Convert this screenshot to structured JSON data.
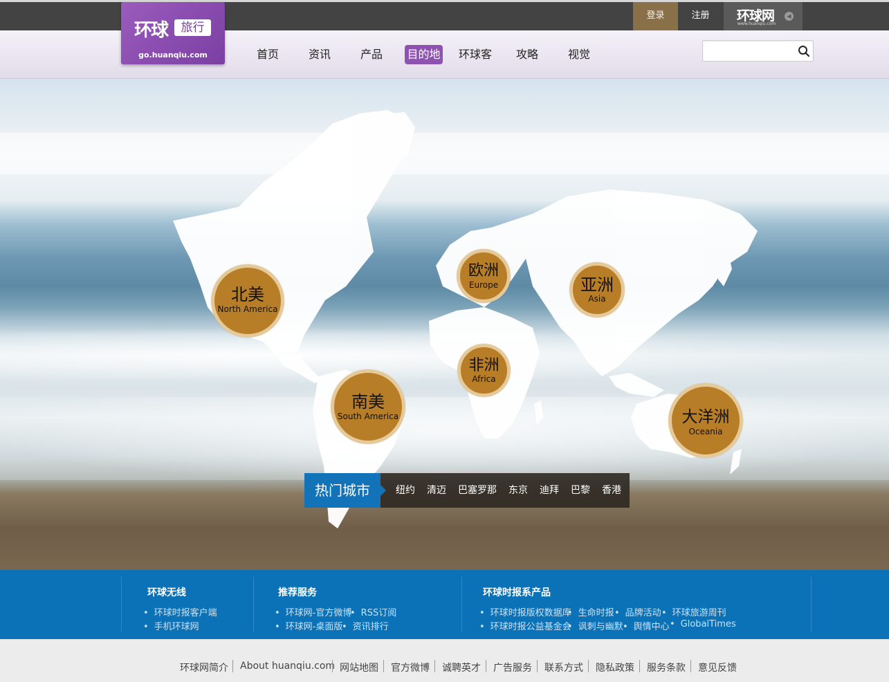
{
  "topbar": {
    "login": "登录",
    "register": "注册",
    "brand": "环球网",
    "brand_url": "www.huanqiu.com"
  },
  "logo": {
    "main": "环球",
    "tag": "旅行",
    "url": "go.huanqiu.com"
  },
  "nav": {
    "items": [
      "首页",
      "资讯",
      "产品",
      "目的地",
      "环球客",
      "攻略",
      "视觉"
    ],
    "active_index": 3
  },
  "search": {
    "placeholder": "",
    "value": ""
  },
  "continents": [
    {
      "zh": "北美",
      "en": "North America"
    },
    {
      "zh": "欧洲",
      "en": "Europe"
    },
    {
      "zh": "亚洲",
      "en": "Asia"
    },
    {
      "zh": "非洲",
      "en": "Africa"
    },
    {
      "zh": "南美",
      "en": "South America"
    },
    {
      "zh": "大洋洲",
      "en": "Oceania"
    }
  ],
  "hot_cities": {
    "title": "热门城市",
    "cities": [
      "纽约",
      "清迈",
      "巴塞罗那",
      "东京",
      "迪拜",
      "巴黎",
      "香港"
    ]
  },
  "footer": {
    "col1": {
      "title": "环球无线",
      "links": [
        "环球时报客户端",
        "手机环球网"
      ]
    },
    "col2": {
      "title": "推荐服务",
      "links": [
        "环球网-官方微博",
        "RSS订阅",
        "环球网-桌面版",
        "资讯排行"
      ]
    },
    "col3": {
      "title": "环球时报系产品",
      "links": [
        "环球时报版权数据库",
        "生命时报",
        "品牌活动",
        "环球旅游周刊",
        "环球时报公益基金会",
        "讽刺与幽默",
        "舆情中心",
        "GlobalTimes"
      ]
    },
    "bottom_links": [
      "环球网简介",
      "About huanqiu.com",
      "网站地图",
      "官方微博",
      "诚聘英才",
      "广告服务",
      "联系方式",
      "隐私政策",
      "服务条款",
      "意见反馈"
    ]
  },
  "colors": {
    "topbar": "#434343",
    "login_bg": "#8a7049",
    "logo_purple": "#8e53b0",
    "continent_fill": "#b87d27",
    "hot_title_blue": "#1273b8",
    "footer_blue": "#0b72b8"
  }
}
